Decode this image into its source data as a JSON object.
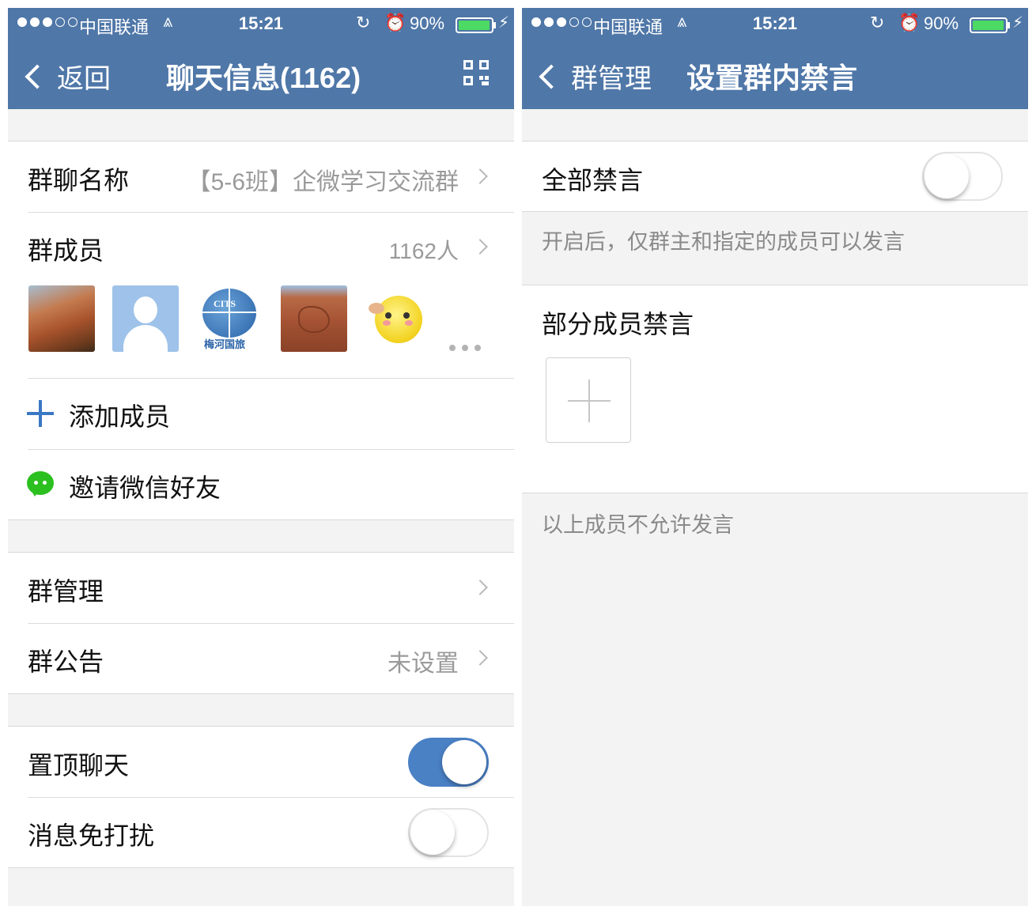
{
  "status_bar": {
    "carrier": "中国联通",
    "time": "15:21",
    "battery": "90%"
  },
  "left": {
    "nav": {
      "back_label": "返回",
      "title": "聊天信息(1162)"
    },
    "group_name": {
      "label": "群聊名称",
      "value": "【5-6班】企微学习交流群"
    },
    "members": {
      "label": "群成员",
      "count": "1162人"
    },
    "avatars": [
      "canyon-photo",
      "default-user-avatar",
      "cits-logo",
      "rock-photo",
      "moon-emoji"
    ],
    "avatar_logo": {
      "top": "CITS",
      "bottom": "梅河国旅"
    },
    "add_member": "添加成员",
    "invite_wechat": "邀请微信好友",
    "group_manage": "群管理",
    "announcement": {
      "label": "群公告",
      "value": "未设置"
    },
    "pin_chat": {
      "label": "置顶聊天",
      "on": true
    },
    "mute": {
      "label": "消息免打扰",
      "on": false
    }
  },
  "right": {
    "nav": {
      "back_label": "群管理",
      "title": "设置群内禁言"
    },
    "mute_all": {
      "label": "全部禁言",
      "on": false
    },
    "mute_all_hint": "开启后，仅群主和指定的成员可以发言",
    "partial_mute": "部分成员禁言",
    "partial_hint": "以上成员不允许发言"
  },
  "colors": {
    "nav_bar": "#4f77a8",
    "toggle_on": "#4a80c4",
    "wechat_green": "#2bc01f",
    "add_blue": "#3a78c3"
  }
}
